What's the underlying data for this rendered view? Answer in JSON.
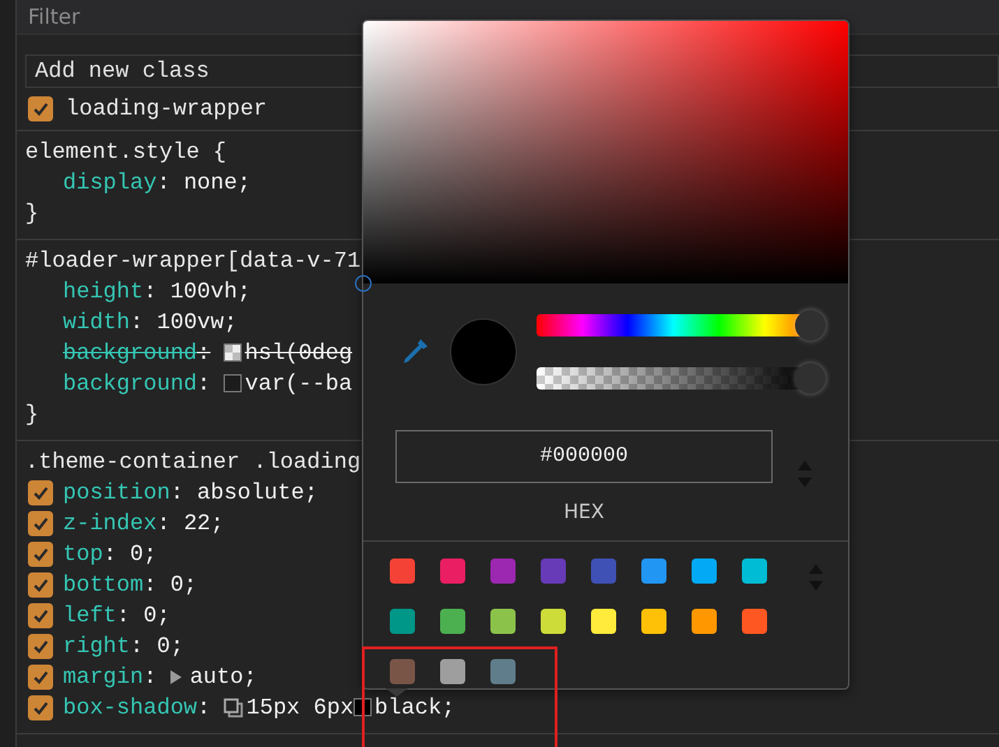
{
  "filter": {
    "placeholder": "Filter"
  },
  "class_field": {
    "placeholder": "Add new class"
  },
  "classes": [
    {
      "name": "loading-wrapper",
      "checked": true
    }
  ],
  "rules": [
    {
      "selector": "element.style {",
      "declarations": [
        {
          "property": "display",
          "separator": ":",
          "overridden": false,
          "value": [
            {
              "kind": "text",
              "text": "none;"
            }
          ]
        }
      ],
      "closing": "}"
    },
    {
      "selector": "#loader-wrapper[data-v-71",
      "declarations": [
        {
          "property": "height",
          "separator": ":",
          "overridden": false,
          "value": [
            {
              "kind": "text",
              "text": "100vh;"
            }
          ]
        },
        {
          "property": "width",
          "separator": ":",
          "overridden": false,
          "value": [
            {
              "kind": "text",
              "text": "100vw;"
            }
          ]
        },
        {
          "property": "background",
          "separator": ":",
          "overridden": true,
          "value": [
            {
              "kind": "light-swatch"
            },
            {
              "kind": "text",
              "text": "hsl(0deg"
            }
          ]
        },
        {
          "property": "background",
          "separator": ":",
          "overridden": false,
          "value": [
            {
              "kind": "dark-swatch"
            },
            {
              "kind": "text",
              "text": "var(--ba"
            }
          ]
        }
      ],
      "closing": "}"
    },
    {
      "selector": ".theme-container .loading",
      "declarations": [
        {
          "property": "position",
          "separator": ":",
          "checked": true,
          "overridden": false,
          "value": [
            {
              "kind": "text",
              "text": "absolute;"
            }
          ]
        },
        {
          "property": "z-index",
          "separator": ":",
          "checked": true,
          "overridden": false,
          "value": [
            {
              "kind": "text",
              "text": "22;"
            }
          ]
        },
        {
          "property": "top",
          "separator": ":",
          "checked": true,
          "overridden": false,
          "value": [
            {
              "kind": "text",
              "text": "0;"
            }
          ]
        },
        {
          "property": "bottom",
          "separator": ":",
          "checked": true,
          "overridden": false,
          "value": [
            {
              "kind": "text",
              "text": "0;"
            }
          ]
        },
        {
          "property": "left",
          "separator": ":",
          "checked": true,
          "overridden": false,
          "value": [
            {
              "kind": "text",
              "text": "0;"
            }
          ]
        },
        {
          "property": "right",
          "separator": ":",
          "checked": true,
          "overridden": false,
          "value": [
            {
              "kind": "text",
              "text": "0;"
            }
          ]
        },
        {
          "property": "margin",
          "separator": ":",
          "checked": true,
          "overridden": false,
          "value": [
            {
              "kind": "expand"
            },
            {
              "kind": "text",
              "text": "auto;"
            }
          ]
        },
        {
          "property": "box-shadow",
          "separator": ":",
          "checked": true,
          "overridden": false,
          "value": [
            {
              "kind": "shadow"
            },
            {
              "kind": "text",
              "text": "15px 6px"
            },
            {
              "kind": "black-swatch"
            },
            {
              "kind": "text",
              "text": "black;"
            }
          ]
        }
      ]
    }
  ],
  "color_picker": {
    "hue_slider": {
      "level": 1
    },
    "alpha_slider": {
      "level": 1
    },
    "hex_value": "#000000",
    "format_label": "HEX",
    "palette": [
      {
        "color": "#f44336"
      },
      {
        "color": "#e91e63"
      },
      {
        "color": "#9c27b0"
      },
      {
        "color": "#673ab7"
      },
      {
        "color": "#3f51b5"
      },
      {
        "color": "#2196f3"
      },
      {
        "color": "#03a9f4"
      },
      {
        "color": "#00bcd4"
      },
      {
        "color": "#009688"
      },
      {
        "color": "#4caf50"
      },
      {
        "color": "#8bc34a"
      },
      {
        "color": "#cddc39"
      },
      {
        "color": "#ffeb3b"
      },
      {
        "color": "#ffc107"
      },
      {
        "color": "#ff9800"
      },
      {
        "color": "#ff5722"
      },
      {
        "color": "#795548"
      },
      {
        "color": "#9e9e9e"
      },
      {
        "color": "#607d8b"
      }
    ]
  },
  "annotation_frame": true
}
